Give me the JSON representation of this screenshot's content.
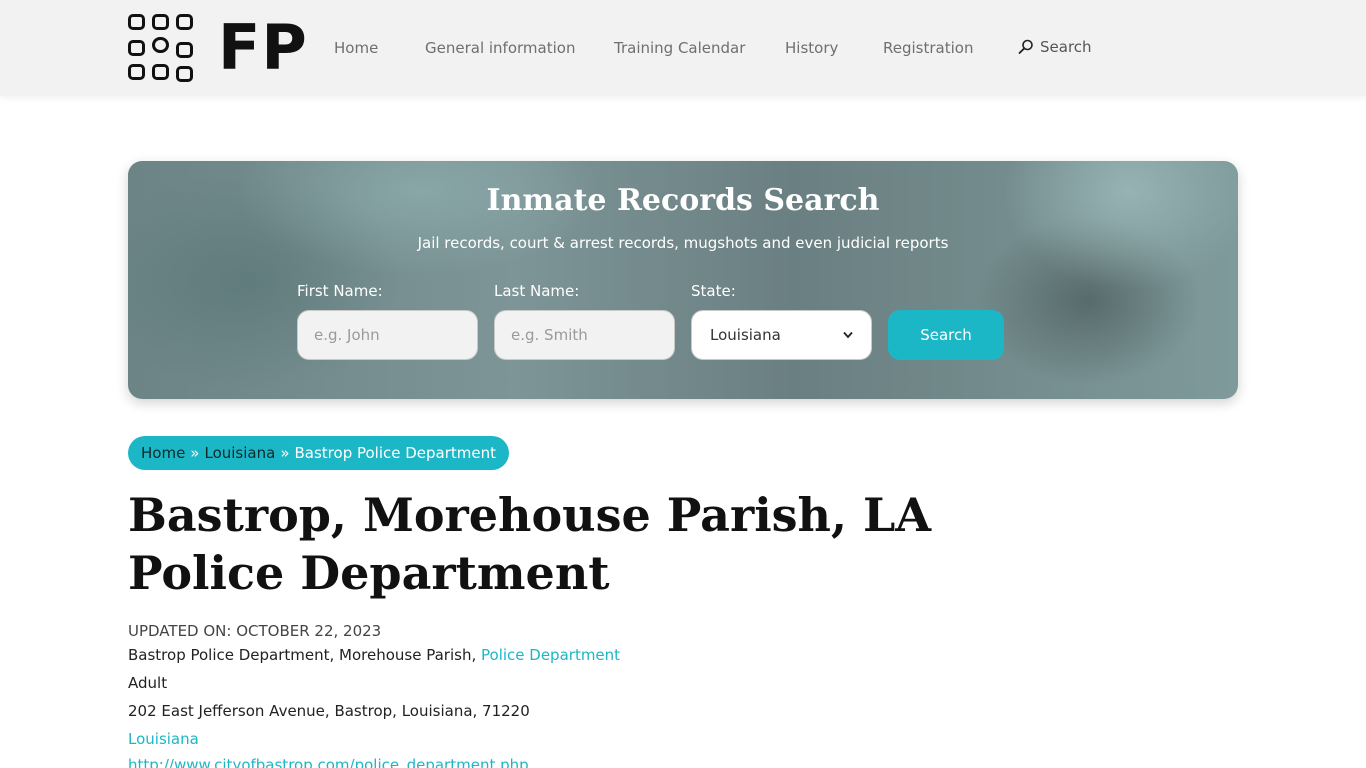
{
  "header": {
    "logo_text": "FP",
    "nav": [
      {
        "label": "Home"
      },
      {
        "label": "General information"
      },
      {
        "label": "Training Calendar"
      },
      {
        "label": "History"
      },
      {
        "label": "Registration"
      }
    ],
    "search_label": "Search"
  },
  "hero": {
    "title": "Inmate Records Search",
    "subtitle": "Jail records, court & arrest records, mugshots and even judicial reports",
    "first_name": {
      "label": "First Name:",
      "placeholder": "e.g. John"
    },
    "last_name": {
      "label": "Last Name:",
      "placeholder": "e.g. Smith"
    },
    "state": {
      "label": "State:",
      "value": "Louisiana"
    },
    "search_button": "Search"
  },
  "breadcrumb": {
    "home": "Home",
    "sep": "»",
    "state": "Louisiana",
    "current": "Bastrop Police Department"
  },
  "page": {
    "title": "Bastrop, Morehouse Parish, LA Police Department",
    "updated": "UPDATED ON: OCTOBER 22, 2023",
    "line1_text": "Bastrop Police Department, Morehouse Parish,",
    "line1_link": "Police Department",
    "line2": "Adult",
    "line3": "202 East Jefferson Avenue, Bastrop, Louisiana, 71220",
    "line4_link": "Louisiana",
    "line5_url": "http://www.cityofbastrop.com/police_department.php"
  },
  "colors": {
    "accent": "#1cb7c6",
    "header_bg": "#f2f2f2"
  }
}
